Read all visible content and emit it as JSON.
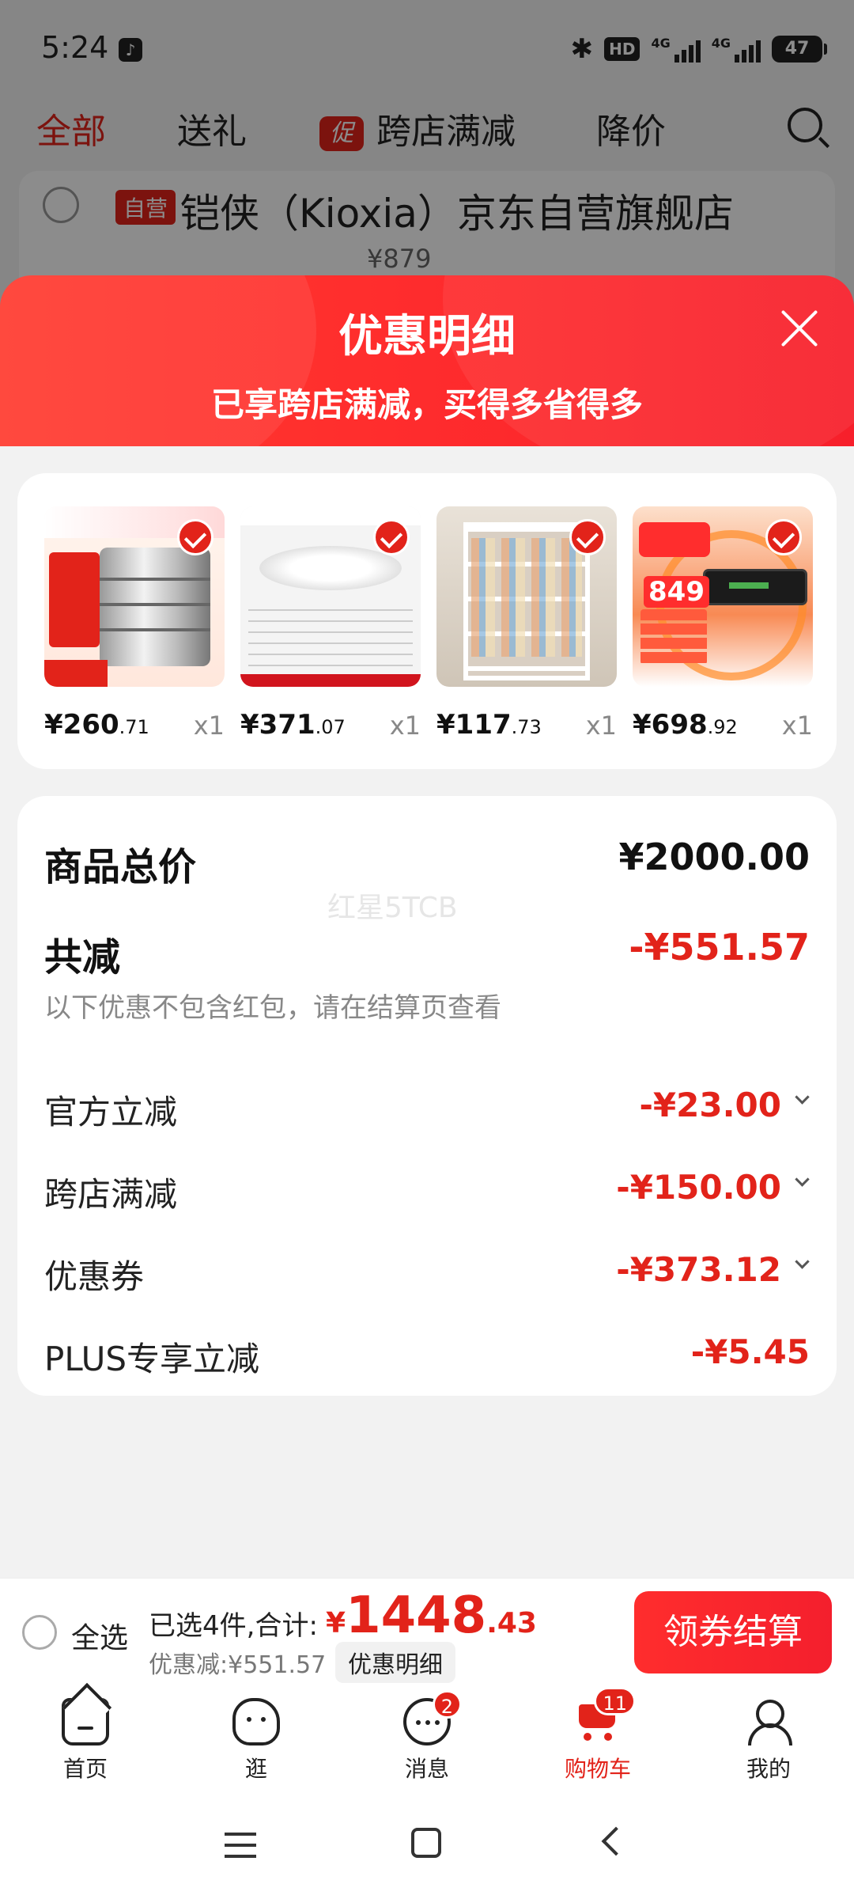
{
  "status_bar": {
    "time": "5:24",
    "hd_label": "HD",
    "network_label": "4G",
    "battery": "47"
  },
  "top_tabs": {
    "all": "全部",
    "gift": "送礼",
    "promo_badge": "促",
    "cross_store": "跨店满减",
    "price_drop": "降价"
  },
  "shop": {
    "badge": "自营",
    "name": "铠侠（Kioxia）京东自营旗舰店",
    "price": "¥879"
  },
  "sheet": {
    "title": "优惠明细",
    "subtitle": "已享跨店满减，买得多省得多"
  },
  "products": [
    {
      "price_int": "¥260",
      "price_dec": ".71",
      "qty": "x1"
    },
    {
      "price_int": "¥371",
      "price_dec": ".07",
      "qty": "x1"
    },
    {
      "price_int": "¥117",
      "price_dec": ".73",
      "qty": "x1"
    },
    {
      "price_int": "¥698",
      "price_dec": ".92",
      "qty": "x1"
    }
  ],
  "product_image_text": {
    "p4_number": "849"
  },
  "summary": {
    "total_label": "商品总价",
    "total_value": "¥2000.00",
    "minus_label": "共减",
    "minus_value": "-¥551.57",
    "minus_note": "以下优惠不包含红包，请在结算页查看",
    "watermark": "红星5TCB",
    "items": [
      {
        "label": "官方立减",
        "value": "-¥23.00"
      },
      {
        "label": "跨店满减",
        "value": "-¥150.00"
      },
      {
        "label": "优惠券",
        "value": "-¥373.12"
      },
      {
        "label": "PLUS专享立减",
        "value": "-¥5.45"
      }
    ]
  },
  "checkout": {
    "select_all": "全选",
    "selected_summary": "已选4件,合计:",
    "currency": "¥",
    "amount_int": "1448",
    "amount_dec": ".43",
    "discount_line": "优惠减:¥551.57",
    "detail_chip": "优惠明细",
    "button": "领券结算"
  },
  "tabbar": {
    "home": "首页",
    "browse": "逛",
    "messages": "消息",
    "messages_badge": "2",
    "cart": "购物车",
    "cart_badge": "11",
    "me": "我的"
  },
  "colors": {
    "accent": "#e2231a",
    "sheet_gradient_start": "#ff3a2e",
    "sheet_gradient_end": "#f71f2b"
  }
}
